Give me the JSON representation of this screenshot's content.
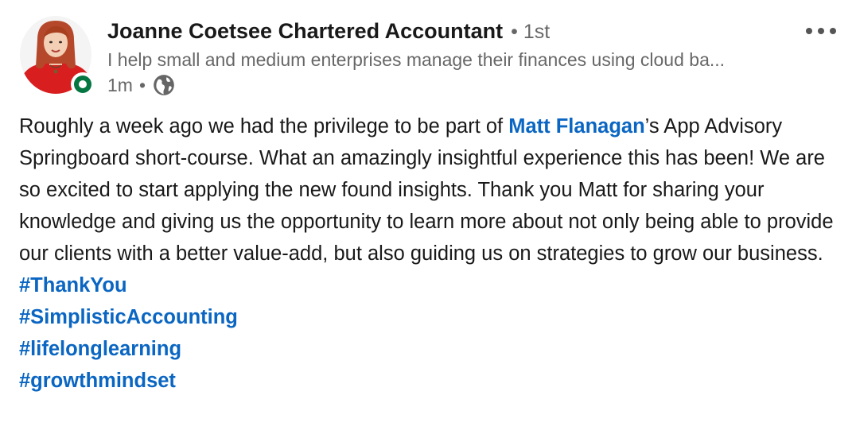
{
  "author": {
    "name": "Joanne Coetsee Chartered Accountant",
    "degree": "• 1st",
    "headline": "I help small and medium enterprises manage their finances using cloud ba...",
    "time": "1m",
    "dot": "•",
    "visibility_icon": "globe-icon",
    "presence": "online",
    "presence_color": "#057642"
  },
  "menu": {
    "icon": "more-horizontal-icon"
  },
  "post": {
    "text_before_mention": "Roughly a week ago we had the privilege to be part of ",
    "mention": "Matt Flanagan",
    "text_after_mention": "’s App Advisory Springboard short-course. What an amazingly insightful experience this has been! We are so excited to start applying the new found insights. Thank you Matt for sharing your knowledge and giving us the opportunity to learn more about not only being able to provide our clients with a better value-add, but also guiding us on strategies to grow our business.",
    "hashtags": [
      "#ThankYou",
      "#SimplisticAccounting",
      "#lifelonglearning",
      "#growthmindset"
    ]
  },
  "colors": {
    "link": "#0a66c2",
    "text": "#1a1a1a",
    "muted": "#666666"
  }
}
